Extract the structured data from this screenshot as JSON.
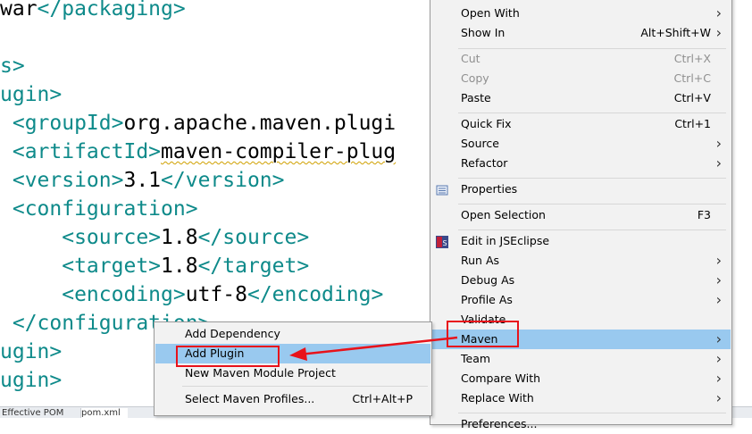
{
  "editor": {
    "lines": [
      {
        "parts": [
          {
            "t": "war",
            "c": "txt"
          },
          {
            "t": "</packaging>",
            "c": "tag"
          }
        ]
      },
      {
        "parts": []
      },
      {
        "parts": [
          {
            "t": "s>",
            "c": "tag"
          }
        ]
      },
      {
        "parts": [
          {
            "t": "ugin>",
            "c": "tag"
          }
        ]
      },
      {
        "parts": [
          {
            "t": " <groupId>",
            "c": "tag"
          },
          {
            "t": "org.apache.maven.plugi",
            "c": "txt"
          }
        ]
      },
      {
        "parts": [
          {
            "t": " <artifactId>",
            "c": "tag"
          },
          {
            "t": "maven-compiler-plug",
            "c": "squig"
          }
        ]
      },
      {
        "parts": [
          {
            "t": " <version>",
            "c": "tag"
          },
          {
            "t": "3.1",
            "c": "txt"
          },
          {
            "t": "</version>",
            "c": "tag"
          }
        ]
      },
      {
        "parts": [
          {
            "t": " <configuration>",
            "c": "tag"
          }
        ]
      },
      {
        "parts": [
          {
            "t": "     <source>",
            "c": "tag"
          },
          {
            "t": "1.8",
            "c": "txt"
          },
          {
            "t": "</source>",
            "c": "tag"
          }
        ]
      },
      {
        "parts": [
          {
            "t": "     <target>",
            "c": "tag"
          },
          {
            "t": "1.8",
            "c": "txt"
          },
          {
            "t": "</target>",
            "c": "tag"
          }
        ]
      },
      {
        "parts": [
          {
            "t": "     <encoding>",
            "c": "tag"
          },
          {
            "t": "utf-8",
            "c": "txt"
          },
          {
            "t": "</encoding>",
            "c": "tag"
          }
        ]
      },
      {
        "parts": [
          {
            "t": " </configuration>",
            "c": "tag"
          }
        ]
      },
      {
        "parts": [
          {
            "t": "ugin>",
            "c": "tag"
          }
        ]
      },
      {
        "parts": [
          {
            "t": "ugin>",
            "c": "tag"
          }
        ]
      }
    ],
    "bottom_tabs": [
      "Effective POM",
      "pom.xml"
    ]
  },
  "context_menu": {
    "items": [
      {
        "label": "Open With",
        "shortcut": "",
        "submenu": true,
        "disabled": false,
        "icon": ""
      },
      {
        "label": "Show In",
        "shortcut": "Alt+Shift+W",
        "submenu": true,
        "disabled": false,
        "icon": ""
      },
      {
        "sep": true
      },
      {
        "label": "Cut",
        "shortcut": "Ctrl+X",
        "submenu": false,
        "disabled": true,
        "icon": ""
      },
      {
        "label": "Copy",
        "shortcut": "Ctrl+C",
        "submenu": false,
        "disabled": true,
        "icon": ""
      },
      {
        "label": "Paste",
        "shortcut": "Ctrl+V",
        "submenu": false,
        "disabled": false,
        "icon": ""
      },
      {
        "sep": true
      },
      {
        "label": "Quick Fix",
        "shortcut": "Ctrl+1",
        "submenu": false,
        "disabled": false,
        "icon": ""
      },
      {
        "label": "Source",
        "shortcut": "",
        "submenu": true,
        "disabled": false,
        "icon": ""
      },
      {
        "label": "Refactor",
        "shortcut": "",
        "submenu": true,
        "disabled": false,
        "icon": ""
      },
      {
        "sep": true
      },
      {
        "label": "Properties",
        "shortcut": "",
        "submenu": false,
        "disabled": false,
        "icon": "properties-icon"
      },
      {
        "sep": true
      },
      {
        "label": "Open Selection",
        "shortcut": "F3",
        "submenu": false,
        "disabled": false,
        "icon": ""
      },
      {
        "sep": true
      },
      {
        "label": "Edit in JSEclipse",
        "shortcut": "",
        "submenu": false,
        "disabled": false,
        "icon": "jseclipse-icon"
      },
      {
        "label": "Run As",
        "shortcut": "",
        "submenu": true,
        "disabled": false,
        "icon": ""
      },
      {
        "label": "Debug As",
        "shortcut": "",
        "submenu": true,
        "disabled": false,
        "icon": ""
      },
      {
        "label": "Profile As",
        "shortcut": "",
        "submenu": true,
        "disabled": false,
        "icon": ""
      },
      {
        "label": "Validate",
        "shortcut": "",
        "submenu": false,
        "disabled": false,
        "icon": ""
      },
      {
        "label": "Maven",
        "shortcut": "",
        "submenu": true,
        "disabled": false,
        "icon": "",
        "highlight": true
      },
      {
        "label": "Team",
        "shortcut": "",
        "submenu": true,
        "disabled": false,
        "icon": ""
      },
      {
        "label": "Compare With",
        "shortcut": "",
        "submenu": true,
        "disabled": false,
        "icon": ""
      },
      {
        "label": "Replace With",
        "shortcut": "",
        "submenu": true,
        "disabled": false,
        "icon": ""
      },
      {
        "sep": true
      },
      {
        "label": "Preferences...",
        "shortcut": "",
        "submenu": false,
        "disabled": false,
        "icon": ""
      }
    ]
  },
  "maven_submenu": {
    "items": [
      {
        "label": "Add Dependency",
        "shortcut": ""
      },
      {
        "label": "Add Plugin",
        "shortcut": "",
        "highlight": true
      },
      {
        "label": "New Maven Module Project",
        "shortcut": ""
      },
      {
        "sep": true
      },
      {
        "label": "Select Maven Profiles...",
        "shortcut": "Ctrl+Alt+P"
      }
    ]
  },
  "colors": {
    "highlight": "#99c9ef",
    "annotation_red": "#e8121a",
    "xml_tag": "#0e8a8a"
  }
}
